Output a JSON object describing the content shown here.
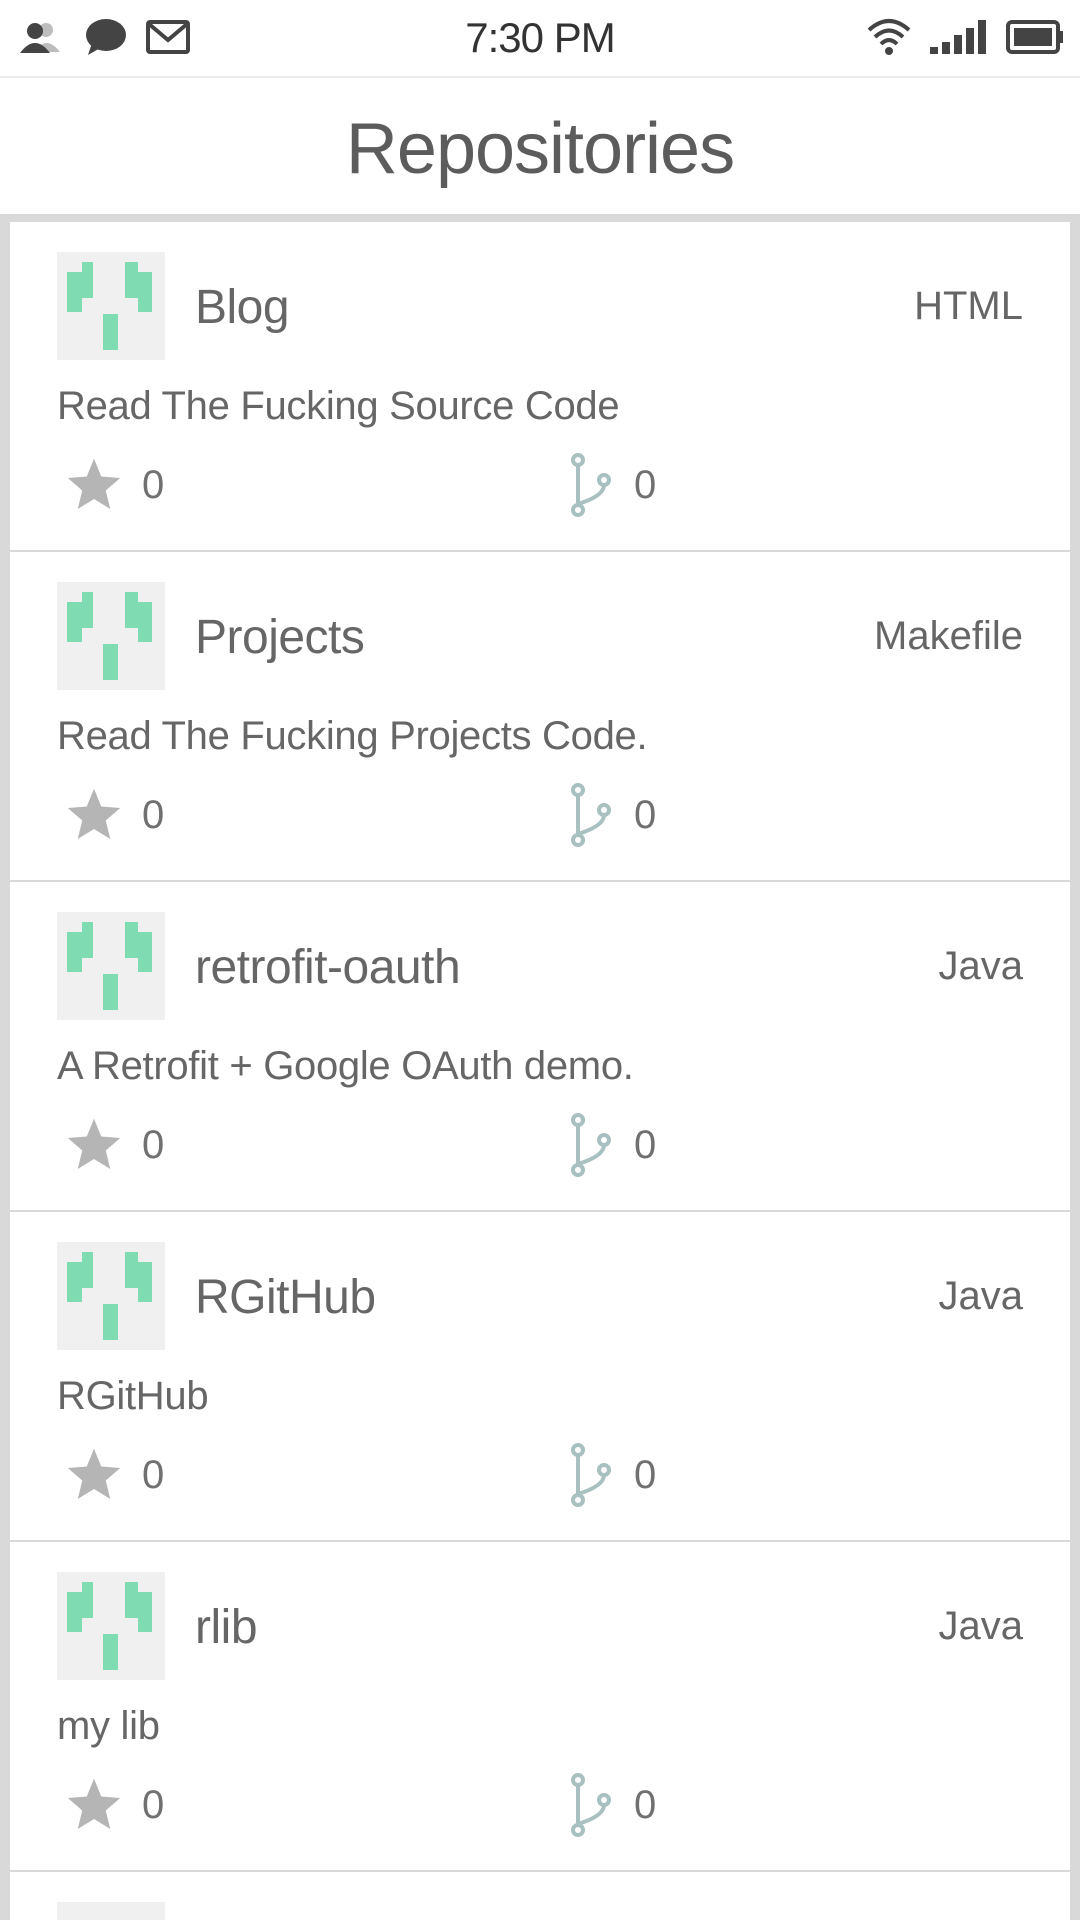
{
  "status_bar": {
    "time": "7:30 PM",
    "left_icons": [
      "contacts-icon",
      "chat-icon",
      "mail-icon"
    ],
    "right_icons": [
      "wifi-icon",
      "signal-icon",
      "battery-icon"
    ]
  },
  "header": {
    "title": "Repositories"
  },
  "colors": {
    "avatar_green": "#7fdcb2",
    "avatar_bg": "#f0f0f0",
    "text_gray": "#666666",
    "icon_gray": "#b5b5b5",
    "fork_icon": "#a9c0c0",
    "divider": "#d9d9d9"
  },
  "repos": [
    {
      "name": "Blog",
      "language": "HTML",
      "description": "Read The Fucking Source Code",
      "stars": "0",
      "forks": "0"
    },
    {
      "name": "Projects",
      "language": "Makefile",
      "description": "Read The Fucking Projects Code.",
      "stars": "0",
      "forks": "0"
    },
    {
      "name": "retrofit-oauth",
      "language": "Java",
      "description": "A Retrofit + Google OAuth demo.",
      "stars": "0",
      "forks": "0"
    },
    {
      "name": "RGitHub",
      "language": "Java",
      "description": "RGitHub",
      "stars": "0",
      "forks": "0"
    },
    {
      "name": "rlib",
      "language": "Java",
      "description": "my lib",
      "stars": "0",
      "forks": "0"
    }
  ]
}
